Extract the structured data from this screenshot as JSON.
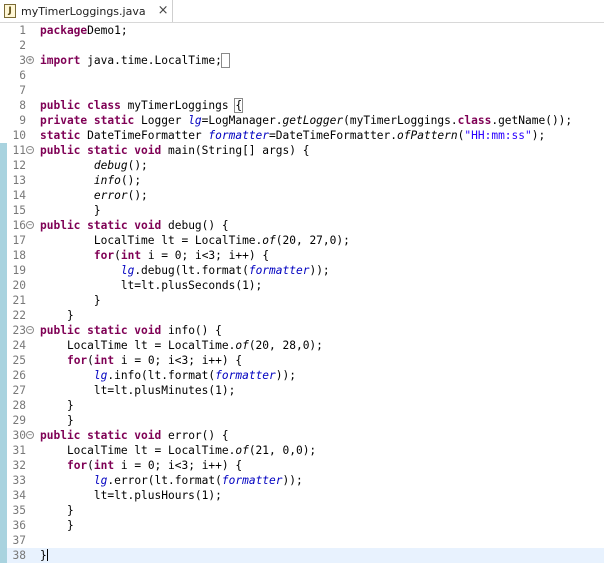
{
  "tab": {
    "filename": "myTimerLoggings.java",
    "icon": "J",
    "close_glyph": "×"
  },
  "lines": [
    {
      "n": "1",
      "scope": false,
      "fold": "",
      "cur": false,
      "parts": [
        [
          "kw",
          "package"
        ],
        [
          "",
          "Demo1;"
        ]
      ]
    },
    {
      "n": "2",
      "scope": false,
      "fold": "",
      "cur": false,
      "parts": []
    },
    {
      "n": "3",
      "scope": false,
      "fold": "+",
      "cur": false,
      "parts": [
        [
          "kw",
          "import"
        ],
        [
          "",
          " java.time.LocalTime;"
        ],
        [
          "box",
          " "
        ]
      ]
    },
    {
      "n": "6",
      "scope": false,
      "fold": "",
      "cur": false,
      "parts": []
    },
    {
      "n": "7",
      "scope": false,
      "fold": "",
      "cur": false,
      "parts": []
    },
    {
      "n": "8",
      "scope": false,
      "fold": "",
      "cur": false,
      "parts": [
        [
          "kw",
          "public class"
        ],
        [
          "",
          " myTimerLoggings "
        ],
        [
          "box",
          "{"
        ]
      ]
    },
    {
      "n": "9",
      "scope": false,
      "fold": "",
      "cur": false,
      "parts": [
        [
          "kw",
          "private static"
        ],
        [
          "",
          " Logger "
        ],
        [
          "fld",
          "lg"
        ],
        [
          "",
          "=LogManager."
        ],
        [
          "ital",
          "getLogger"
        ],
        [
          "",
          "(myTimerLoggings."
        ],
        [
          "kw",
          "class"
        ],
        [
          "",
          ".getName());"
        ]
      ]
    },
    {
      "n": "10",
      "scope": false,
      "fold": "",
      "cur": false,
      "parts": [
        [
          "kw",
          "static"
        ],
        [
          "",
          " DateTimeFormatter "
        ],
        [
          "fld",
          "formatter"
        ],
        [
          "",
          "=DateTimeFormatter."
        ],
        [
          "ital",
          "ofPattern"
        ],
        [
          "",
          "("
        ],
        [
          "str",
          "\"HH:mm:ss\""
        ],
        [
          "",
          ");"
        ]
      ]
    },
    {
      "n": "11",
      "scope": true,
      "fold": "-",
      "cur": false,
      "parts": [
        [
          "kw",
          "public static void"
        ],
        [
          "",
          " main(String[] args) {"
        ]
      ]
    },
    {
      "n": "12",
      "scope": true,
      "fold": "",
      "cur": false,
      "parts": [
        [
          "",
          "        "
        ],
        [
          "ital",
          "debug"
        ],
        [
          "",
          "();"
        ]
      ]
    },
    {
      "n": "13",
      "scope": true,
      "fold": "",
      "cur": false,
      "parts": [
        [
          "",
          "        "
        ],
        [
          "ital",
          "info"
        ],
        [
          "",
          "();"
        ]
      ]
    },
    {
      "n": "14",
      "scope": true,
      "fold": "",
      "cur": false,
      "parts": [
        [
          "",
          "        "
        ],
        [
          "ital",
          "error"
        ],
        [
          "",
          "();"
        ]
      ]
    },
    {
      "n": "15",
      "scope": true,
      "fold": "",
      "cur": false,
      "parts": [
        [
          "",
          "        }"
        ]
      ]
    },
    {
      "n": "16",
      "scope": true,
      "fold": "-",
      "cur": false,
      "parts": [
        [
          "kw",
          "public static void"
        ],
        [
          "",
          " debug() {"
        ]
      ]
    },
    {
      "n": "17",
      "scope": true,
      "fold": "",
      "cur": false,
      "parts": [
        [
          "",
          "        LocalTime lt = LocalTime."
        ],
        [
          "ital",
          "of"
        ],
        [
          "",
          "(20, 27,0);"
        ]
      ]
    },
    {
      "n": "18",
      "scope": true,
      "fold": "",
      "cur": false,
      "parts": [
        [
          "",
          "        "
        ],
        [
          "kw",
          "for"
        ],
        [
          "",
          "("
        ],
        [
          "kw",
          "int"
        ],
        [
          "",
          " i = 0; i<3; i++) {"
        ]
      ]
    },
    {
      "n": "19",
      "scope": true,
      "fold": "",
      "cur": false,
      "parts": [
        [
          "",
          "            "
        ],
        [
          "fld",
          "lg"
        ],
        [
          "",
          ".debug(lt.format("
        ],
        [
          "fld",
          "formatter"
        ],
        [
          "",
          "));"
        ]
      ]
    },
    {
      "n": "20",
      "scope": true,
      "fold": "",
      "cur": false,
      "parts": [
        [
          "",
          "            lt=lt.plusSeconds(1);"
        ]
      ]
    },
    {
      "n": "21",
      "scope": true,
      "fold": "",
      "cur": false,
      "parts": [
        [
          "",
          "        }"
        ]
      ]
    },
    {
      "n": "22",
      "scope": true,
      "fold": "",
      "cur": false,
      "parts": [
        [
          "",
          "    }"
        ]
      ]
    },
    {
      "n": "23",
      "scope": true,
      "fold": "-",
      "cur": false,
      "parts": [
        [
          "kw",
          "public static void"
        ],
        [
          "",
          " info() {"
        ]
      ]
    },
    {
      "n": "24",
      "scope": true,
      "fold": "",
      "cur": false,
      "parts": [
        [
          "",
          "    LocalTime lt = LocalTime."
        ],
        [
          "ital",
          "of"
        ],
        [
          "",
          "(20, 28,0);"
        ]
      ]
    },
    {
      "n": "25",
      "scope": true,
      "fold": "",
      "cur": false,
      "parts": [
        [
          "",
          "    "
        ],
        [
          "kw",
          "for"
        ],
        [
          "",
          "("
        ],
        [
          "kw",
          "int"
        ],
        [
          "",
          " i = 0; i<3; i++) {"
        ]
      ]
    },
    {
      "n": "26",
      "scope": true,
      "fold": "",
      "cur": false,
      "parts": [
        [
          "",
          "        "
        ],
        [
          "fld",
          "lg"
        ],
        [
          "",
          ".info(lt.format("
        ],
        [
          "fld",
          "formatter"
        ],
        [
          "",
          "));"
        ]
      ]
    },
    {
      "n": "27",
      "scope": true,
      "fold": "",
      "cur": false,
      "parts": [
        [
          "",
          "        lt=lt.plusMinutes(1);"
        ]
      ]
    },
    {
      "n": "28",
      "scope": true,
      "fold": "",
      "cur": false,
      "parts": [
        [
          "",
          "    }"
        ]
      ]
    },
    {
      "n": "29",
      "scope": true,
      "fold": "",
      "cur": false,
      "parts": [
        [
          "",
          "    }"
        ]
      ]
    },
    {
      "n": "30",
      "scope": true,
      "fold": "-",
      "cur": false,
      "parts": [
        [
          "kw",
          "public static void"
        ],
        [
          "",
          " error() {"
        ]
      ]
    },
    {
      "n": "31",
      "scope": true,
      "fold": "",
      "cur": false,
      "parts": [
        [
          "",
          "    LocalTime lt = LocalTime."
        ],
        [
          "ital",
          "of"
        ],
        [
          "",
          "(21, 0,0);"
        ]
      ]
    },
    {
      "n": "32",
      "scope": true,
      "fold": "",
      "cur": false,
      "parts": [
        [
          "",
          "    "
        ],
        [
          "kw",
          "for"
        ],
        [
          "",
          "("
        ],
        [
          "kw",
          "int"
        ],
        [
          "",
          " i = 0; i<3; i++) {"
        ]
      ]
    },
    {
      "n": "33",
      "scope": true,
      "fold": "",
      "cur": false,
      "parts": [
        [
          "",
          "        "
        ],
        [
          "fld",
          "lg"
        ],
        [
          "",
          ".error(lt.format("
        ],
        [
          "fld",
          "formatter"
        ],
        [
          "",
          "));"
        ]
      ]
    },
    {
      "n": "34",
      "scope": true,
      "fold": "",
      "cur": false,
      "parts": [
        [
          "",
          "        lt=lt.plusHours(1);"
        ]
      ]
    },
    {
      "n": "35",
      "scope": true,
      "fold": "",
      "cur": false,
      "parts": [
        [
          "",
          "    }"
        ]
      ]
    },
    {
      "n": "36",
      "scope": true,
      "fold": "",
      "cur": false,
      "parts": [
        [
          "",
          "    }"
        ]
      ]
    },
    {
      "n": "37",
      "scope": true,
      "fold": "",
      "cur": false,
      "parts": []
    },
    {
      "n": "38",
      "scope": true,
      "fold": "",
      "cur": true,
      "parts": [
        [
          "",
          "}"
        ],
        [
          "caret",
          ""
        ]
      ]
    }
  ],
  "colors": {
    "keyword": "#7f0055",
    "field": "#0000c0",
    "string": "#2a00ff",
    "line_number": "#787878",
    "current_line": "#e8f2fe",
    "scope_ruler": "#a9d3df"
  }
}
